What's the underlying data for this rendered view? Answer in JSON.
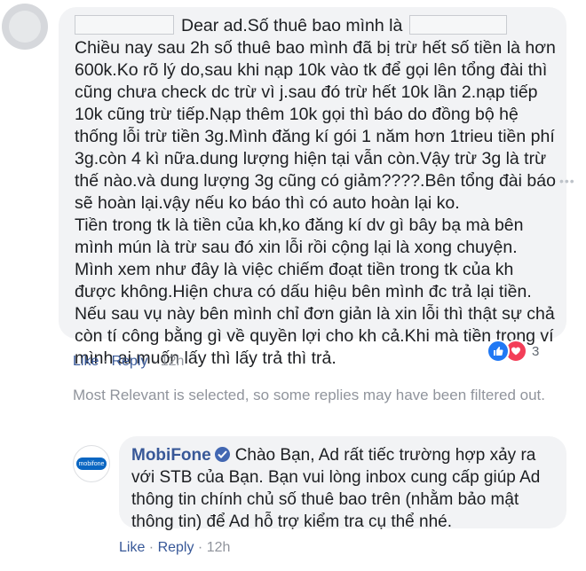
{
  "comment": {
    "greeting": "Dear ad.Số thuê bao mình là",
    "lines": [
      "Chiều nay sau 2h số thuê bao mình đã bị trừ hết số tiền là hơn",
      "600k.Ko rõ lý do,sau khi nạp 10k vào tk để gọi lên tổng đài thì",
      "cũng chưa check dc trừ vì j.sau đó trừ hết 10k lần 2.nạp tiếp",
      "10k cũng trừ tiếp.Nạp thêm 10k gọi thì báo do đồng bộ hệ",
      "thống lỗi trừ tiền 3g.Mình đăng kí gói 1 năm hơn 1trieu tiền phí",
      "3g.còn 4 kì nữa.dung lượng hiện tại vẫn còn.Vậy trừ 3g là trừ",
      "thế nào.và dung lượng 3g cũng có giảm????.Bên tổng đài báo",
      "sẽ hoàn lại.vậy nếu ko báo thì có auto hoàn lại ko.",
      "Tiền trong tk là tiền của kh,ko đăng kí dv gì bây bạ mà bên",
      "mình mún là trừ sau đó xin lỗi rồi cộng lại là xong chuyện.",
      "Mình xem như đây là việc chiếm đoạt tiền trong tk của kh",
      "được không.Hiện chưa có dấu hiệu bên mình đc trả lại tiền.",
      "Nếu sau vụ này bên mình chỉ đơn giản là xin lỗi thì thật sự chả",
      "còn tí công bằng gì về quyền lợi cho kh cả.Khi mà tiền trong ví",
      "mình ai muốn lấy thì lấy trả thì trả."
    ],
    "reaction_count": "3",
    "like_label": "Like",
    "reply_label": "Reply",
    "separator": " · ",
    "time": "12h"
  },
  "notice": "Most Relevant is selected, so some replies may have been filtered out.",
  "reply": {
    "author": "MobiFone",
    "logo_text": "mobifone",
    "first_line": "Chào Bạn, Ad rất tiếc trường hợp xảy ra",
    "lines": [
      "với STB của Bạn. Bạn vui lòng inbox cung cấp giúp Ad",
      "thông tin chính chủ số thuê bao trên (nhằm bảo mật",
      "thông tin) để Ad hỗ trợ kiểm tra cụ thể nhé."
    ],
    "like_label": "Like",
    "reply_label": "Reply",
    "separator": " · ",
    "time": "12h"
  },
  "colors": {
    "bubble": "#f2f3f5",
    "link": "#385898",
    "muted": "#90949c",
    "like": "#2078f4",
    "love": "#f33e58",
    "verified": "#4267b2"
  },
  "icons": [
    "like-reaction-icon",
    "love-reaction-icon",
    "verified-badge-icon",
    "more-options-icon"
  ]
}
